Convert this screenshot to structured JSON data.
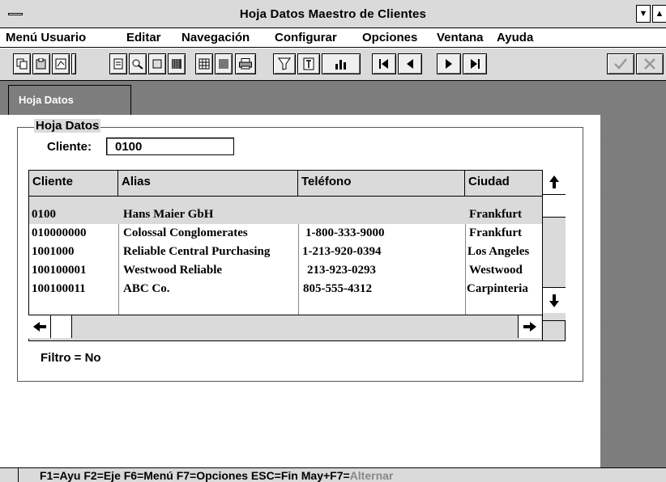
{
  "window": {
    "title": "Hoja Datos Maestro de Clientes"
  },
  "menu": [
    "Menú Usuario",
    "Editar",
    "Navegación",
    "Configurar",
    "Opciones",
    "Ventana",
    "Ayuda"
  ],
  "toolbar_icons": [
    "copy-icon",
    "paste-icon",
    "edit-icon",
    "form-icon",
    "find-icon",
    "barcode-icon",
    "table-icon",
    "print-icon",
    "filter-icon",
    "text-icon",
    "chart-icon",
    "first-record-icon",
    "prev-record-icon",
    "next-record-icon",
    "last-record-icon",
    "ok-icon",
    "cancel-icon"
  ],
  "tab": {
    "label": "Hoja Datos"
  },
  "group": {
    "title": "Hoja Datos"
  },
  "cliente_field": {
    "label": "Cliente:",
    "value": "0100"
  },
  "grid": {
    "columns": [
      "Cliente",
      "Alias",
      "Teléfono",
      "Ciudad"
    ],
    "rows": [
      {
        "cliente": "0100",
        "alias": "Hans Maier GbH",
        "telefono": "",
        "ciudad": "Frankfurt"
      },
      {
        "cliente": "010000000",
        "alias": "Colossal Conglomerates",
        "telefono": "1-800-333-9000",
        "ciudad": "Frankfurt"
      },
      {
        "cliente": "1001000",
        "alias": "Reliable Central Purchasing",
        "telefono": "1-213-920-0394",
        "ciudad": "Los Angeles"
      },
      {
        "cliente": "100100001",
        "alias": "Westwood Reliable",
        "telefono": "213-923-0293",
        "ciudad": "Westwood"
      },
      {
        "cliente": "100100011",
        "alias": "ABC Co.",
        "telefono": "805-555-4312",
        "ciudad": "Carpinteria"
      }
    ]
  },
  "filter": {
    "text": "Filtro = No"
  },
  "status": {
    "text": "F1=Ayu  F2=Eje  F6=Menú  F7=Opciones  ESC=Fin  May+F7=",
    "dim": "Alternar"
  }
}
